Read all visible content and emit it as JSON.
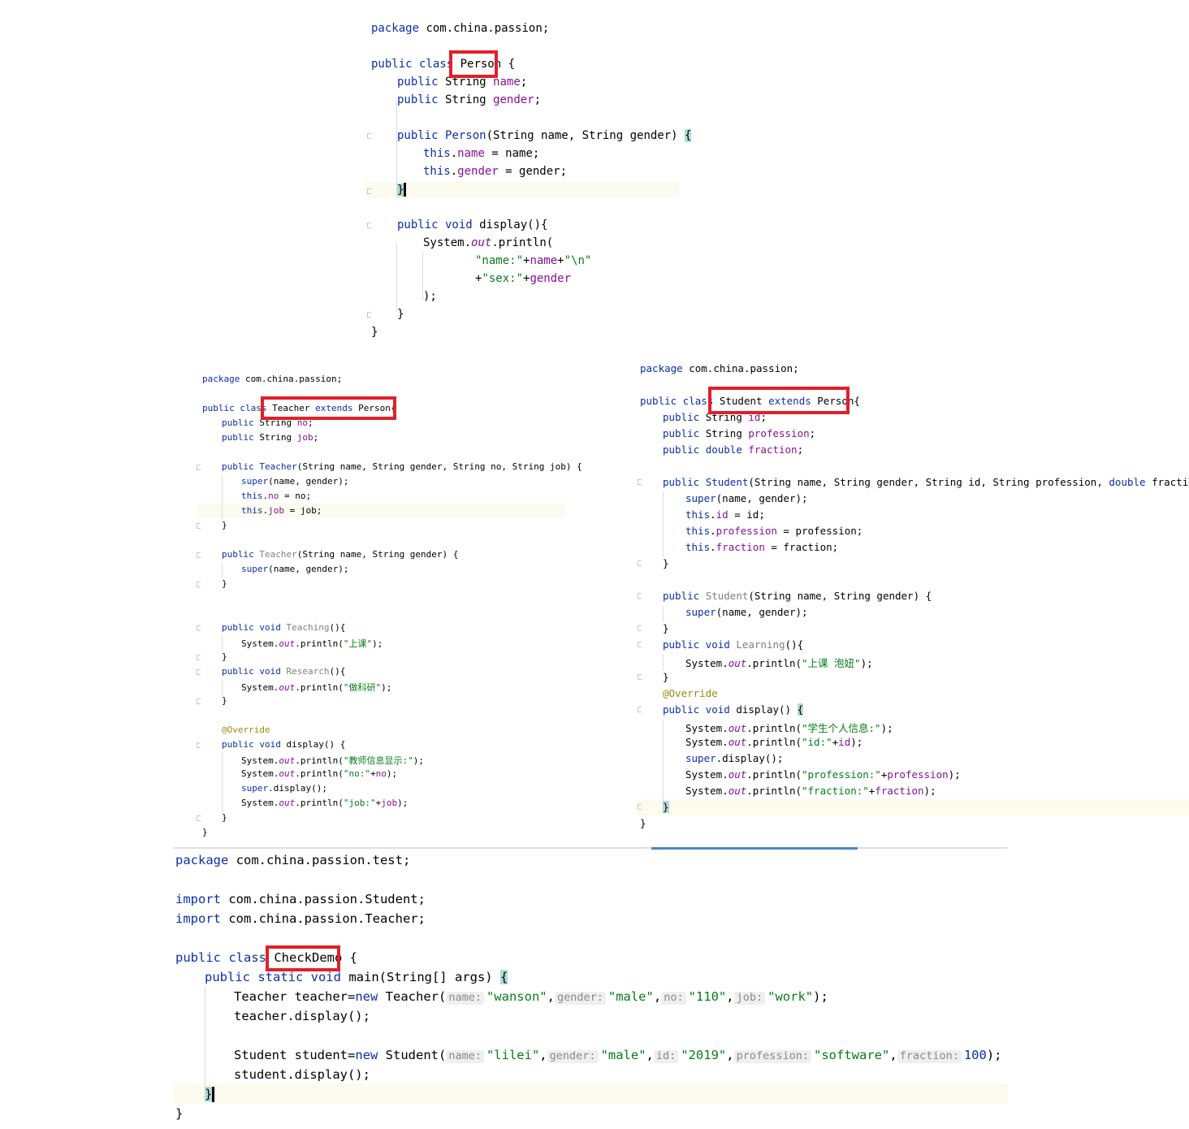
{
  "person": {
    "l1": "package com.china.passion;",
    "l2_kw": "public class",
    "l2_name": "Person",
    "l2_brace": "{",
    "l3_kw": "public",
    "l3_type": "String",
    "l3_field": "name",
    "l4_field": "gender",
    "l5_kw": "public",
    "l5_name": "Person",
    "l5_params": "(String name, String gender)",
    "l5_brace": "{",
    "l6_this": "this",
    "l6_field": "name",
    "l6_rest": " = name;",
    "l7_field": "gender",
    "l7_rest": " = gender;",
    "close_brace": "}",
    "l9_kw": "public void",
    "l9_rest": "display(){",
    "l10_a": "System.",
    "l10_out": "out",
    "l10_b": ".println(",
    "l11_str1": "\"name:\"",
    "l11_op": "+name+",
    "l11_str2": "\"\\n\"",
    "l12_op": "+",
    "l12_str": "\"sex:\"",
    "l12_rest": "+gender",
    "l13": ");",
    "l14": "}",
    "l15": "}"
  },
  "teacher": {
    "l1": "package com.china.passion;",
    "l2_kw": "public class",
    "l2_rest": "Teacher",
    "l2_ext": "extends",
    "l2_parent": "Person{",
    "f1_field": "no",
    "f2_field": "job",
    "c1_name": "Teacher",
    "c1_params": "(String name, String gender, String no, String job) {",
    "c1_super": "super",
    "c1_super_rest": "(name, gender);",
    "c1_this": "this",
    "c1_no": "no",
    "c1_no_rest": " = no;",
    "c1_job": "job",
    "c1_job_rest": " = job;",
    "c2_params": "(String name, String gender) {",
    "m1_name": "Teaching",
    "m1_rest": "(){",
    "m1_str": "\"上课\"",
    "m2_name": "Research",
    "m2_str": "\"做科研\"",
    "override": "@Override",
    "d_kw": "public void",
    "d_rest": "display() {",
    "d1_str": "\"教师信息显示:\"",
    "d2_str": "\"no:\"",
    "d2_field": "no",
    "d3_super": "super",
    "d3_rest": ".display();",
    "d4_str": "\"job:\"",
    "d4_field": "job",
    "println_a": "System.",
    "println_out": "out",
    "println_b": ".println(",
    "println_end": ");",
    "plus": "+",
    "close": "}"
  },
  "student": {
    "l1": "package com.china.passion;",
    "l2_kw": "public class",
    "l2_rest": "Student",
    "l2_ext": "extends",
    "l2_parent": "Person{",
    "kw_public": "public",
    "t_string": "String",
    "t_double": "double",
    "f1": "id",
    "f2": "profession",
    "f3": "fraction",
    "c1_name": "Student",
    "c1_params_a": "(String name, String gender, String id, String profession,",
    "c1_params_b": "fraction) {",
    "super": "super",
    "super_rest": "(name, gender);",
    "this": "this",
    "a1_rest": " = id;",
    "a2_rest": " = profession;",
    "a3_rest": " = fraction;",
    "c2_params": "(String name, String gender) {",
    "m_kw": "public void",
    "m_name": "Learning",
    "m_rest": "(){",
    "m_str": "\"上课 泡妞\"",
    "override": "@Override",
    "d_rest": "display()",
    "d_brace": "{",
    "d1_str": "\"学生个人信息:\"",
    "d2_str": "\"id:\"",
    "d3_rest": ".display();",
    "d4_str": "\"profession:\"",
    "d5_str": "\"fraction:\"",
    "println_a": "System.",
    "println_out": "out",
    "println_b": ".println(",
    "println_end": ");",
    "plus": "+",
    "close": "}"
  },
  "checkdemo": {
    "l1_kw": "package",
    "l1_rest": "com.china.passion.test;",
    "l2_kw": "import",
    "l2_rest": "com.china.passion.Student;",
    "l3_rest": "com.china.passion.Teacher;",
    "l4_kw": "public class",
    "l4_name": "CheckDemo",
    "l4_brace": "{",
    "l5_kw": "public static void",
    "l5_rest": "main(String[] args)",
    "l5_brace": "{",
    "l6_a": "Teacher teacher=",
    "kw_new": "new",
    "l6_b": "Teacher(",
    "h_name": "name:",
    "h_gender": "gender:",
    "h_no": "no:",
    "h_job": "job:",
    "h_id": "id:",
    "h_profession": "profession:",
    "h_fraction": "fraction:",
    "v_wanson": "\"wanson\"",
    "v_male": "\"male\"",
    "v_110": "\"110\"",
    "v_work": "\"work\"",
    "v_lilei": "\"lilei\"",
    "v_2019": "\"2019\"",
    "v_software": "\"software\"",
    "v_100": "100",
    "comma": ",",
    "end": ");",
    "l7": "teacher.display();",
    "l8_a": "Student student=",
    "l8_b": "Student(",
    "l9": "student.display();",
    "close": "}"
  }
}
